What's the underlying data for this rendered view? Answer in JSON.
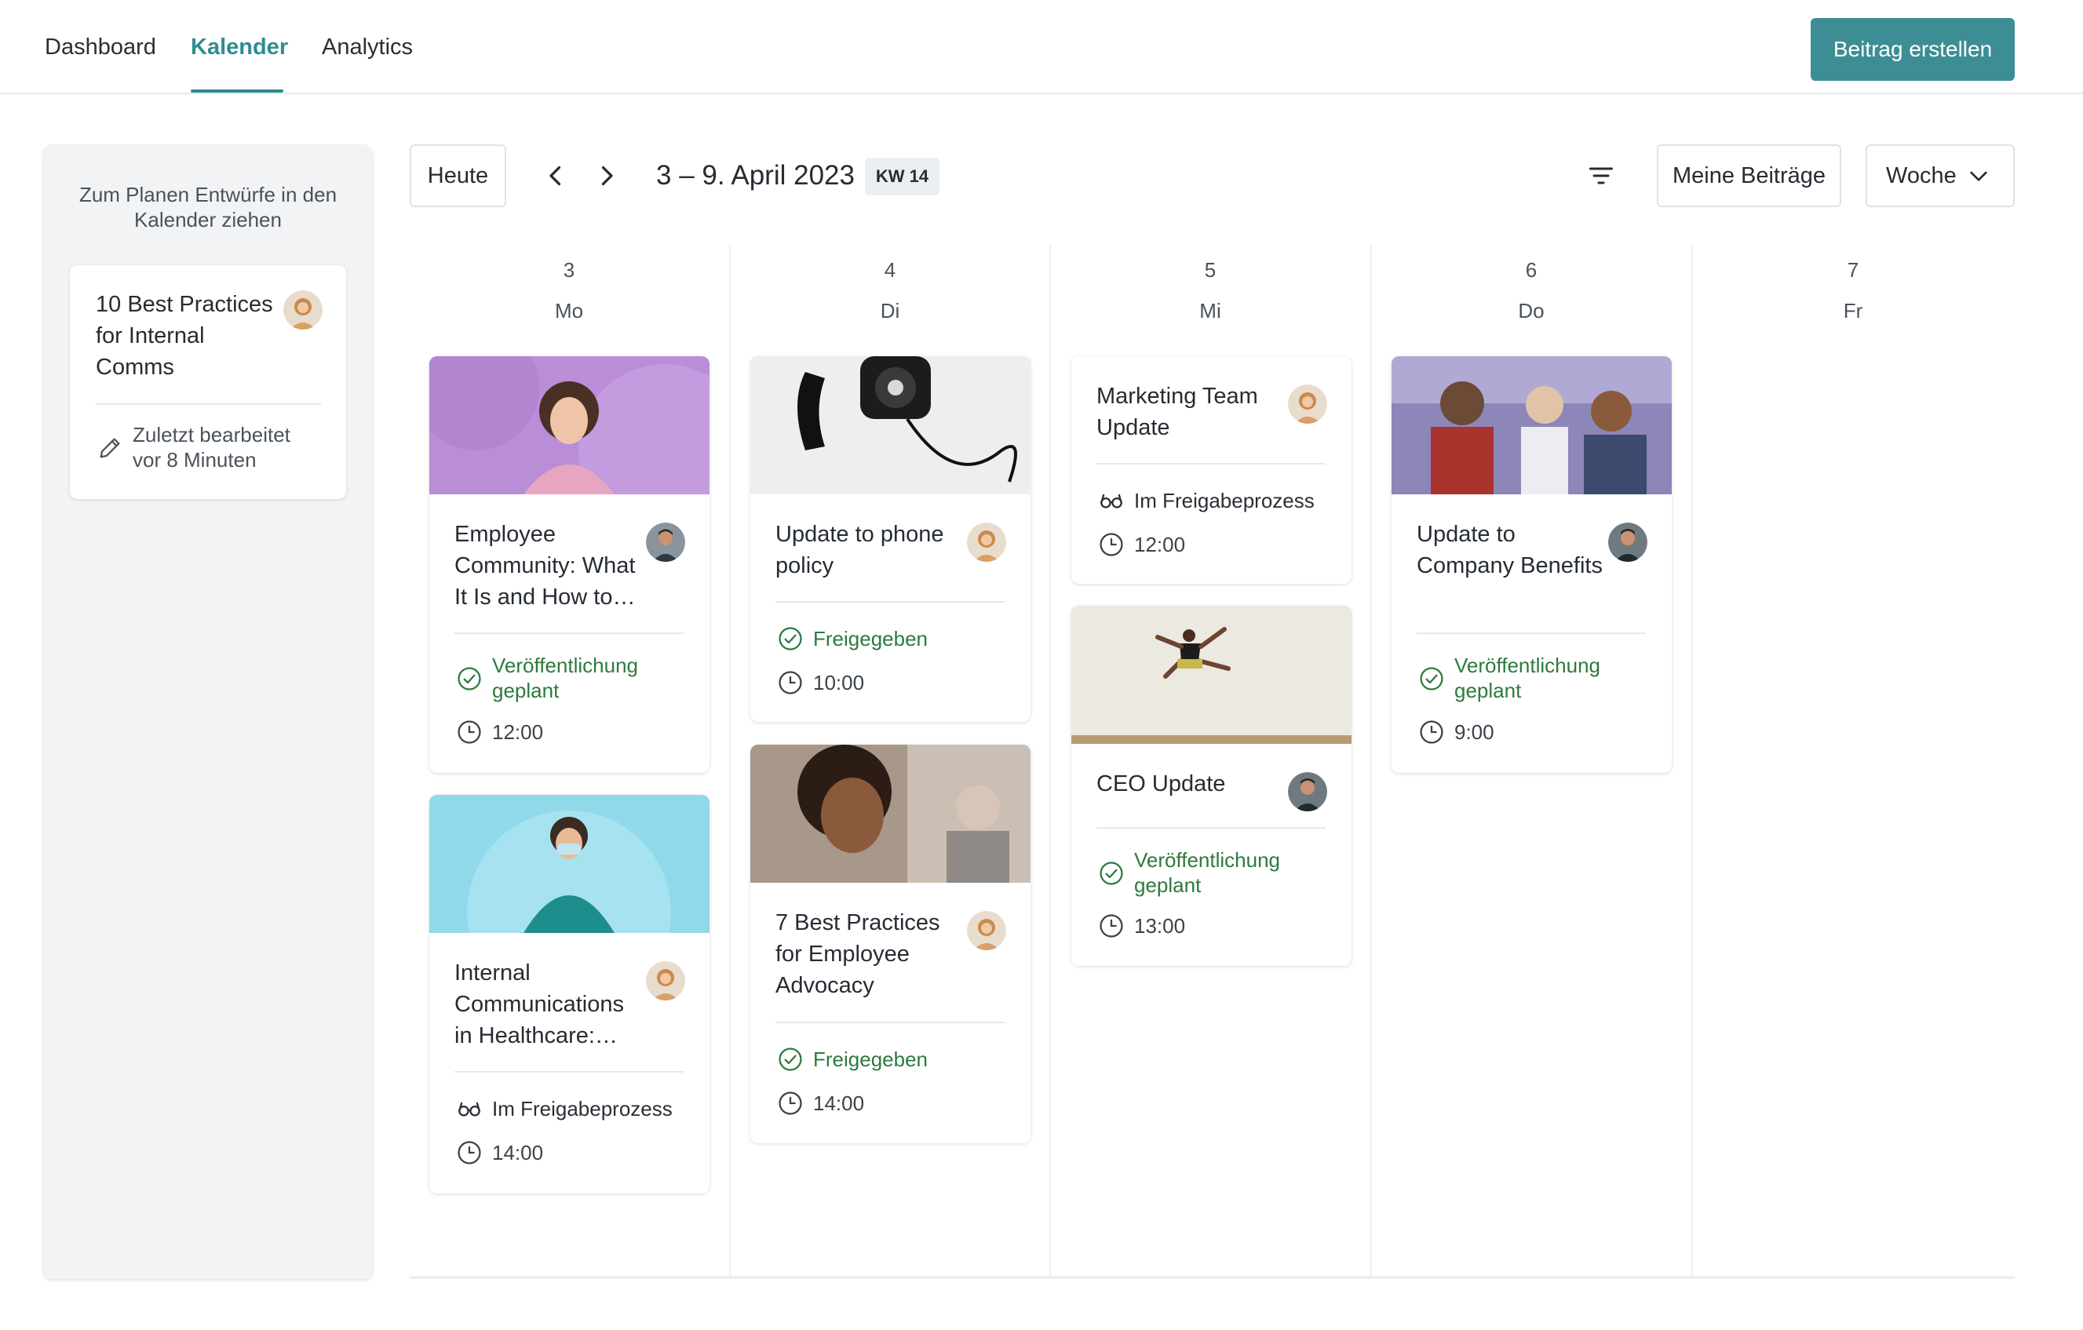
{
  "nav": {
    "tabs": [
      "Dashboard",
      "Kalender",
      "Analytics"
    ],
    "active_tab": "Kalender",
    "create_button": "Beitrag erstellen"
  },
  "sidebar": {
    "hint": "Zum Planen Entwürfe in den Kalender ziehen",
    "draft": {
      "title": "10 Best Practices for Internal Comms",
      "edited": "Zuletzt bearbeitet vor 8 Minuten"
    }
  },
  "toolbar": {
    "today": "Heute",
    "range": "3 – 9. April 2023",
    "week_badge": "KW 14",
    "my_posts": "Meine Beiträge",
    "view_select": "Woche"
  },
  "days": [
    {
      "num": "3",
      "name": "Mo"
    },
    {
      "num": "4",
      "name": "Di"
    },
    {
      "num": "5",
      "name": "Mi"
    },
    {
      "num": "6",
      "name": "Do"
    },
    {
      "num": "7",
      "name": "Fr"
    }
  ],
  "posts": {
    "mo1": {
      "title": "Employee Community: What It Is and How to…",
      "status": "Veröffentlichung geplant",
      "time": "12:00"
    },
    "mo2": {
      "title": "Internal Communications in Healthcare:…",
      "status": "Im Freigabeprozess",
      "time": "14:00"
    },
    "di1": {
      "title": "Update to phone policy",
      "status": "Freigegeben",
      "time": "10:00"
    },
    "di2": {
      "title": "7 Best Practices for Employee Advocacy",
      "status": "Freigegeben",
      "time": "14:00"
    },
    "mi1": {
      "title": "Marketing Team Update",
      "status": "Im Freigabeprozess",
      "time": "12:00"
    },
    "mi2": {
      "title": "CEO Update",
      "status": "Veröffentlichung geplant",
      "time": "13:00"
    },
    "do1": {
      "title": "Update to Company Benefits",
      "status": "Veröffentlichung geplant",
      "time": "9:00"
    }
  },
  "colors": {
    "accent": "#3d8e94",
    "status_green": "#2d7a3e"
  },
  "icons": [
    "pencil-icon",
    "chevron-left-icon",
    "chevron-right-icon",
    "filter-icon",
    "chevron-down-icon",
    "check-circle-icon",
    "glasses-icon",
    "clock-icon"
  ]
}
